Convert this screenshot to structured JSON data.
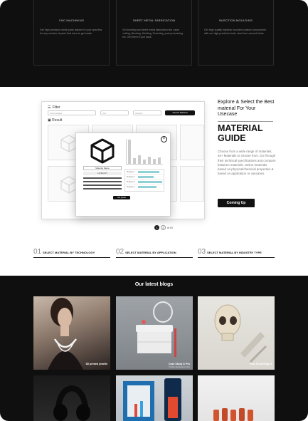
{
  "services": [
    {
      "title": "CNC MACHINING",
      "desc": "Get high precision metal parts tailored to your specifics for any number of parts that have to get made."
    },
    {
      "title": "SHEET METAL FABRICATION",
      "desc": "Get bending and sheet metal fabrication like Laser cutting, Bending, Welding, Punching, post processing etc. Get them in just days."
    },
    {
      "title": "INJECTION MOULDING",
      "desc": "Get high quality injection moulded custom components with our high precision tools, short turn-around times."
    }
  ],
  "mockup": {
    "filter_label": "Filter",
    "inputs": [
      "Technologies",
      "Use",
      "Industry"
    ],
    "search_button": "Search Material",
    "result_label": "Result",
    "popup": {
      "name_label": "Material Name",
      "sub_label": "CATEGORY",
      "table_rows": [
        "Property 1",
        "Property 2",
        "Property 3",
        "Property 4"
      ],
      "button": "Get Quote"
    },
    "pager": [
      "1",
      "2",
      "of 10"
    ]
  },
  "material": {
    "intro": "Explore & Select the Best material For Your Usecase",
    "title_line1": "MATERIAL",
    "title_line2": "GUIDE",
    "desc": "Choose from a wide range of materials, 40+ Materials to choose from. Go through their technical specifications and compare between materials. Select materials based on physical/chemical properties & based on application or usecases.",
    "cta": "Coming Up"
  },
  "steps": [
    {
      "num": "01",
      "label": "SELECT MATERIAL BY TECHNOLOGY"
    },
    {
      "num": "02",
      "label": "SELECT MATERIAL BY APPLICATION"
    },
    {
      "num": "03",
      "label": "SELECT MATERIAL BY INDUSTRY TYPE"
    }
  ],
  "blogs": {
    "title": "Our latest blogs",
    "items": [
      {
        "caption": "3D printed jewelle",
        "sub": ""
      },
      {
        "caption": "Case Study & Pro",
        "sub": "Product Development Jour"
      },
      {
        "caption": "How 3d printing w",
        "sub": ""
      },
      {
        "caption": "",
        "sub": ""
      },
      {
        "caption": "",
        "sub": ""
      },
      {
        "caption": "",
        "sub": ""
      }
    ]
  },
  "colors": {
    "dark_bg": "#0f0f0f",
    "accent_fill": "#8fd1d6",
    "button_bg": "#111111"
  }
}
